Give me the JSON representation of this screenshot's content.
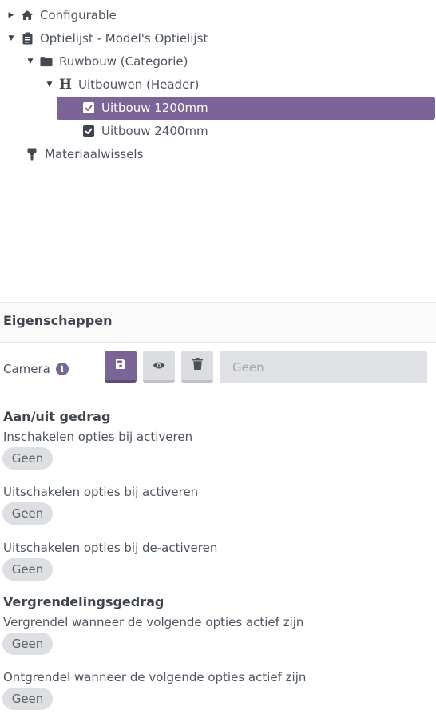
{
  "tree": {
    "items": [
      {
        "label": "Configurable",
        "icon": "home-icon",
        "caret": "right"
      },
      {
        "label": "Optielijst - Model's Optielijst",
        "icon": "clipboard-icon",
        "caret": "down"
      },
      {
        "label": "Ruwbouw (Categorie)",
        "icon": "folder-icon",
        "caret": "down"
      },
      {
        "label": "Uitbouwen (Header)",
        "icon": "header-icon",
        "caret": "down",
        "icon_glyph": "H"
      },
      {
        "label": "Uitbouw 1200mm",
        "icon": "checkbox-checked-icon",
        "selected": true
      },
      {
        "label": "Uitbouw 2400mm",
        "icon": "checkbox-checked-icon"
      },
      {
        "label": "Materiaalwissels",
        "icon": "paint-roller-icon"
      }
    ]
  },
  "properties": {
    "title": "Eigenschappen",
    "camera": {
      "label": "Camera",
      "info_icon": "info-icon",
      "buttons": [
        "save-icon",
        "eye-icon",
        "trash-icon"
      ],
      "placeholder": "Geen"
    },
    "sections": [
      {
        "title": "Aan/uit gedrag",
        "fields": [
          {
            "label": "Inschakelen opties bij activeren",
            "value": "Geen"
          },
          {
            "label": "Uitschakelen opties bij activeren",
            "value": "Geen"
          },
          {
            "label": "Uitschakelen opties bij de-activeren",
            "value": "Geen"
          }
        ]
      },
      {
        "title": "Vergrendelingsgedrag",
        "fields": [
          {
            "label": "Vergrendel wanneer de volgende opties actief zijn",
            "value": "Geen"
          },
          {
            "label": "Ontgrendel wanneer de volgende opties actief zijn",
            "value": "Geen"
          }
        ]
      }
    ]
  },
  "colors": {
    "accent": "#7b6596",
    "text": "#4d5560",
    "pill_bg": "#dedfe2",
    "button_grey": "#dcdde0"
  }
}
